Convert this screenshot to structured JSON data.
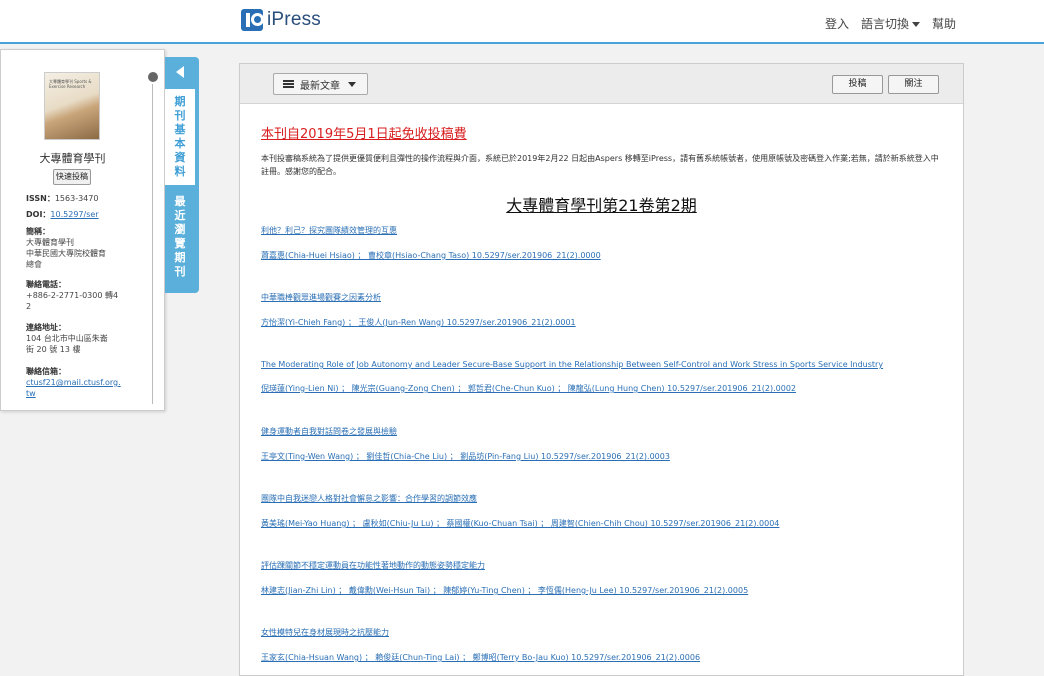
{
  "header": {
    "logo_text": "iPress",
    "nav": {
      "login": "登入",
      "language": "語言切換",
      "help": "幫助"
    }
  },
  "journal_panel": {
    "cover_title": "大專體育學刊 Sports & Exercise Research",
    "name": "大專體育學刊",
    "quick_submit": "快速投稿",
    "issn_label": "ISSN：",
    "issn": "1563-3470",
    "doi_label": "DOI：",
    "doi": "10.5297/ser",
    "publisher_label": "簡稱：",
    "publisher_lines": [
      "大專體育學刊",
      "中華民國大專院校體育",
      "總會"
    ],
    "phone_label": "聯絡電話：",
    "phone_lines": [
      "+886-2-2771-0300 轉4",
      "2"
    ],
    "address_label": "連絡地址：",
    "address_lines": [
      "104 台北市中山區朱崙",
      "街 20 號 13 樓"
    ],
    "email_label": "聯絡信箱：",
    "email_lines": [
      "ctusf21@mail.ctusf.org.",
      "tw"
    ]
  },
  "side_tabs": {
    "basic_info": "期刊基本資料",
    "recent_issues": "最近瀏覽期刊"
  },
  "toolbar": {
    "latest_articles": "最新文章",
    "submit": "投稿",
    "follow": "關注"
  },
  "content": {
    "notice_title": "本刊自2019年5月1日起免收投稿費",
    "notice_body": "本刊投審稿系統為了提供更優質便利且彈性的操作流程與介面，系統已於2019年2月22 日起由Aspers 移轉至iPress，請有舊系統帳號者，使用原帳號及密碼登入作業;若無，請於新系統登入中註冊。感謝您的配合。",
    "issue_title": "大專體育學刊第21卷第2期",
    "articles": [
      {
        "title": "利他？利己？探究團隊績效管理的互惠",
        "authors": "蕭嘉惠(Chia-Huei Hsiao) ； 曹校章(Hsiao-Chang Taso) 10.5297/ser.201906_21(2).0000"
      },
      {
        "title": "中華職棒觀眾進場觀賽之因素分析",
        "authors": "方怡潔(Yi-Chieh Fang) ； 王俊人(Jun-Ren Wang) 10.5297/ser.201906_21(2).0001"
      },
      {
        "title": "The Moderating Role of Job Autonomy and Leader Secure-Base Support in the Relationship Between Self-Control and Work Stress in Sports Service Industry",
        "authors": "倪瑛蓮(Ying-Lien Ni) ； 陳光宗(Guang-Zong Chen) ； 郭哲君(Che-Chun Kuo) ； 陳龍弘(Lung Hung Chen) 10.5297/ser.201906_21(2).0002"
      },
      {
        "title": "健身運動者自我對話問卷之發展與檢驗",
        "authors": "王亭文(Ting-Wen Wang) ； 劉佳哲(Chia-Che Liu) ； 劉品坊(Pin-Fang Liu) 10.5297/ser.201906_21(2).0003"
      },
      {
        "title": "團隊中自我迷戀人格對社會懈怠之影響：合作學習的調節效應",
        "authors": "黃美瑤(Mei-Yao Huang) ； 盧秋如(Chiu-Ju Lu) ； 蔡國權(Kuo-Chuan Tsai) ； 周建智(Chien-Chih Chou) 10.5297/ser.201906_21(2).0004"
      },
      {
        "title": "評估踝關節不穩定運動員在功能性著地動作的動態姿勢穩定能力",
        "authors": "林建志(Jian-Zhi Lin) ； 戴偉勳(Wei-Hsun Tai) ； 陳郁婷(Yu-Ting Chen) ； 李恆儒(Heng-Ju Lee) 10.5297/ser.201906_21(2).0005"
      },
      {
        "title": "女性模特兒在身材展現時之抗壓能力",
        "authors": "王家玄(Chia-Hsuan Wang) ； 賴俊廷(Chun-Ting Lai) ； 鄭博昭(Terry Bo-Jau Kuo) 10.5297/ser.201906_21(2).0006"
      }
    ]
  }
}
